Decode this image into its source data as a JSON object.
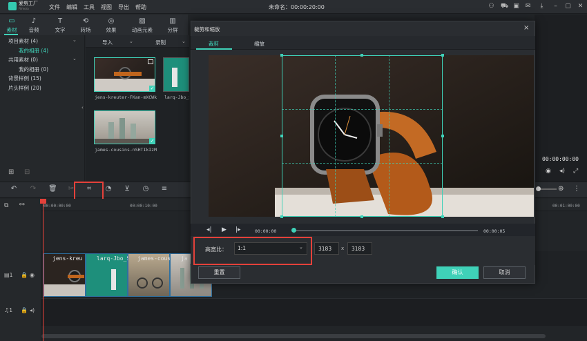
{
  "app": {
    "name": "爱剪工厂",
    "sub": "Filmora",
    "doc_title": "未命名：00:00:20:00"
  },
  "menu": [
    "文件",
    "编辑",
    "工具",
    "视图",
    "导出",
    "帮助"
  ],
  "media_tabs": [
    {
      "label": "素材",
      "icon": "folder-icon"
    },
    {
      "label": "音频",
      "icon": "music-icon"
    },
    {
      "label": "文字",
      "icon": "text-icon"
    },
    {
      "label": "转场",
      "icon": "transition-icon"
    },
    {
      "label": "效果",
      "icon": "effects-icon"
    },
    {
      "label": "动画元素",
      "icon": "elements-icon"
    },
    {
      "label": "分屏",
      "icon": "split-screen-icon"
    }
  ],
  "library": {
    "project_media": "项目素材 (4)",
    "my_album": "我的相册 (4)",
    "shared_media": "共用素材 (0)",
    "my_album_shared": "我的相册 (0)",
    "bg_samples": "背景样例 (15)",
    "intro_samples": "片头样例 (20)"
  },
  "media_toolbar": {
    "import": "导入",
    "record": "录制"
  },
  "media_items": [
    {
      "label": "jens-kreuter-FKan-mXCWk"
    },
    {
      "label": "larq-Jbo_S"
    },
    {
      "label": "james-cousins-nSHTIkIzM"
    }
  ],
  "right_panel": {
    "time": "00:00:00:00"
  },
  "ruler": {
    "t0": "00:00:00:00",
    "t1": "00:00:10:00",
    "t2": "00:01:00:00"
  },
  "clips": [
    {
      "label": "jens-kreu"
    },
    {
      "label": "larq-Jbo_S"
    },
    {
      "label": "james-cousins"
    },
    {
      "label": "ja"
    }
  ],
  "dialog": {
    "title": "裁剪和缩放",
    "tabs": [
      "裁剪",
      "缩放"
    ],
    "time_start": "00:00:00",
    "time_end": "00:00:05",
    "scrub_progress": 0.0,
    "aspect_label": "高宽比：",
    "aspect_value": "1:1",
    "width": "3183",
    "height": "3183",
    "dim_sep": "x",
    "reset": "重置",
    "ok": "确认",
    "cancel": "取消"
  },
  "colors": {
    "accent": "#3fd1b8",
    "highlight": "#e5413a"
  }
}
